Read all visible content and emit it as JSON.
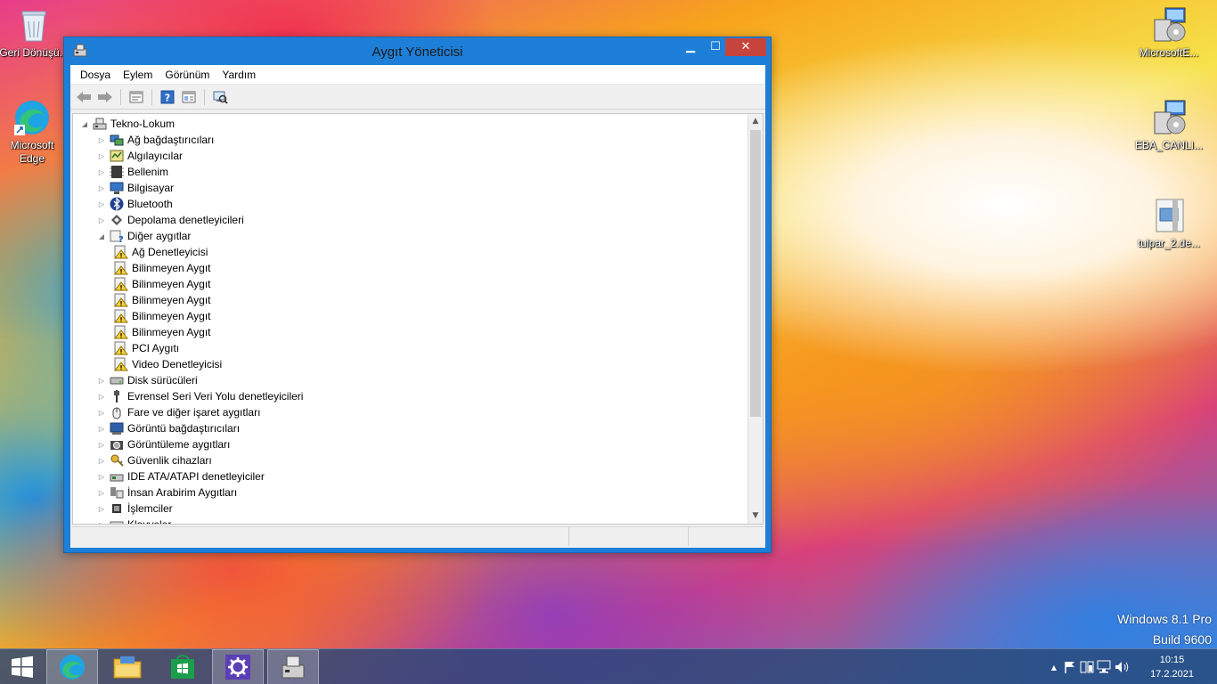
{
  "desktop": {
    "icons": [
      {
        "label": "Geri Dönüşü..."
      },
      {
        "label": "Microsoft Edge"
      },
      {
        "label": "MicrosoftE..."
      },
      {
        "label": "EBA_CANLI..."
      },
      {
        "label": "tulpar_2.de..."
      }
    ]
  },
  "window": {
    "title": "Aygıt Yöneticisi",
    "controls": {
      "minimize": "▁",
      "maximize": "☐",
      "close": "✕"
    },
    "menu": [
      "Dosya",
      "Eylem",
      "Görünüm",
      "Yardım"
    ],
    "toolbar": [
      "back-icon",
      "forward-icon",
      "properties-icon",
      "help-icon",
      "show-hide-icon",
      "scan-hardware-icon"
    ],
    "tree": {
      "root": "Tekno-Lokum",
      "items": [
        {
          "label": "Ağ bağdaştırıcıları",
          "icon": "network-adapter-icon",
          "expanded": false
        },
        {
          "label": "Algılayıcılar",
          "icon": "sensor-icon",
          "expanded": false
        },
        {
          "label": "Bellenim",
          "icon": "firmware-icon",
          "expanded": false
        },
        {
          "label": "Bilgisayar",
          "icon": "computer-icon",
          "expanded": false
        },
        {
          "label": "Bluetooth",
          "icon": "bluetooth-icon",
          "expanded": false
        },
        {
          "label": "Depolama denetleyicileri",
          "icon": "storage-controller-icon",
          "expanded": false
        },
        {
          "label": "Diğer aygıtlar",
          "icon": "other-devices-icon",
          "expanded": true
        },
        {
          "label": "Ağ Denetleyicisi",
          "icon": "warning-device-icon",
          "child": true
        },
        {
          "label": "Bilinmeyen Aygıt",
          "icon": "warning-device-icon",
          "child": true
        },
        {
          "label": "Bilinmeyen Aygıt",
          "icon": "warning-device-icon",
          "child": true
        },
        {
          "label": "Bilinmeyen Aygıt",
          "icon": "warning-device-icon",
          "child": true
        },
        {
          "label": "Bilinmeyen Aygıt",
          "icon": "warning-device-icon",
          "child": true
        },
        {
          "label": "Bilinmeyen Aygıt",
          "icon": "warning-device-icon",
          "child": true
        },
        {
          "label": "PCI Aygıtı",
          "icon": "warning-device-icon",
          "child": true
        },
        {
          "label": "Video Denetleyicisi",
          "icon": "warning-device-icon",
          "child": true
        },
        {
          "label": "Disk sürücüleri",
          "icon": "disk-drive-icon",
          "expanded": false
        },
        {
          "label": "Evrensel Seri Veri Yolu denetleyicileri",
          "icon": "usb-icon",
          "expanded": false
        },
        {
          "label": "Fare ve diğer işaret aygıtları",
          "icon": "mouse-icon",
          "expanded": false
        },
        {
          "label": "Görüntü bağdaştırıcıları",
          "icon": "display-adapter-icon",
          "expanded": false
        },
        {
          "label": "Görüntüleme aygıtları",
          "icon": "imaging-device-icon",
          "expanded": false
        },
        {
          "label": "Güvenlik cihazları",
          "icon": "security-device-icon",
          "expanded": false
        },
        {
          "label": "IDE ATA/ATAPI denetleyiciler",
          "icon": "ide-controller-icon",
          "expanded": false
        },
        {
          "label": "İnsan Arabirim Aygıtları",
          "icon": "hid-icon",
          "expanded": false
        },
        {
          "label": "İşlemciler",
          "icon": "processor-icon",
          "expanded": false
        },
        {
          "label": "Klavyeler",
          "icon": "keyboard-icon",
          "expanded": false
        }
      ]
    }
  },
  "watermark": {
    "line1": "Windows 8.1 Pro",
    "line2": "Build 9600"
  },
  "taskbar": {
    "apps": [
      "start-icon",
      "edge-icon",
      "file-explorer-icon",
      "store-icon",
      "settings-icon",
      "device-manager-icon"
    ],
    "clock": {
      "time": "10:15",
      "date": "17.2.2021"
    }
  },
  "colors": {
    "titlebar": "#1e7fd8",
    "close": "#c7443c",
    "taskbar": "#284878"
  }
}
